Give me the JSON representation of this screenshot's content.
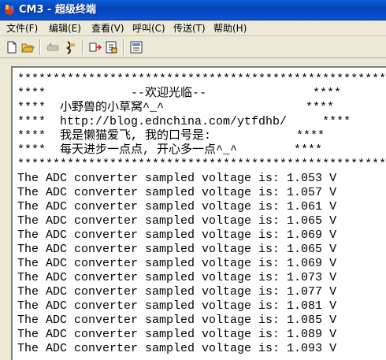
{
  "window": {
    "title": "CM3 - 超级终端"
  },
  "menu": [
    {
      "label": "文件(F)"
    },
    {
      "label": "编辑(E)"
    },
    {
      "label": "查看(V)"
    },
    {
      "label": "呼叫(C)"
    },
    {
      "label": "传送(T)"
    },
    {
      "label": "帮助(H)"
    }
  ],
  "toolbar": {
    "icons": [
      "new-icon",
      "open-icon",
      "disconnect-icon",
      "dial-icon",
      "send-icon",
      "receive-icon",
      "properties-icon"
    ]
  },
  "terminal": {
    "lines": [
      "****************************************************",
      "****            --欢迎光临--               ****",
      "****  小野兽的小草窝^_^                    ****",
      "****  http://blog.ednchina.com/ytfdhb/     ****",
      "****  我是懒猫爱飞, 我的口号是:            ****",
      "****  每天进步一点点, 开心多一点^_^        ****",
      "****************************************************",
      "The ADC converter sampled voltage is: 1.053 V",
      "The ADC converter sampled voltage is: 1.057 V",
      "The ADC converter sampled voltage is: 1.061 V",
      "The ADC converter sampled voltage is: 1.065 V",
      "The ADC converter sampled voltage is: 1.069 V",
      "The ADC converter sampled voltage is: 1.065 V",
      "The ADC converter sampled voltage is: 1.069 V",
      "The ADC converter sampled voltage is: 1.073 V",
      "The ADC converter sampled voltage is: 1.077 V",
      "The ADC converter sampled voltage is: 1.081 V",
      "The ADC converter sampled voltage is: 1.085 V",
      "The ADC converter sampled voltage is: 1.089 V",
      "The ADC converter sampled voltage is: 1.093 V"
    ]
  },
  "colors": {
    "titlebar": "#0a5fd8",
    "title_text": "#ffffff",
    "chrome": "#ece9d8",
    "terminal_bg": "#ffffff",
    "terminal_text": "#000000"
  }
}
